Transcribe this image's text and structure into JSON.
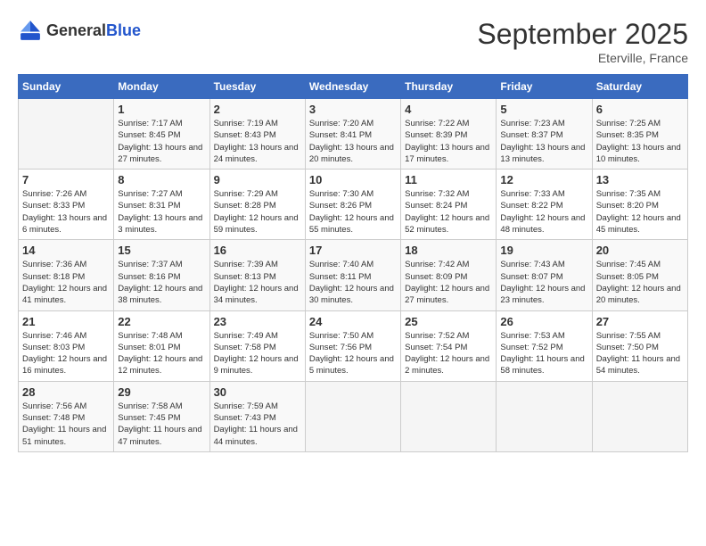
{
  "header": {
    "logo_general": "General",
    "logo_blue": "Blue",
    "month": "September 2025",
    "location": "Eterville, France"
  },
  "weekdays": [
    "Sunday",
    "Monday",
    "Tuesday",
    "Wednesday",
    "Thursday",
    "Friday",
    "Saturday"
  ],
  "weeks": [
    [
      {
        "day": "",
        "empty": true
      },
      {
        "day": "1",
        "sunrise": "7:17 AM",
        "sunset": "8:45 PM",
        "daylight": "13 hours and 27 minutes."
      },
      {
        "day": "2",
        "sunrise": "7:19 AM",
        "sunset": "8:43 PM",
        "daylight": "13 hours and 24 minutes."
      },
      {
        "day": "3",
        "sunrise": "7:20 AM",
        "sunset": "8:41 PM",
        "daylight": "13 hours and 20 minutes."
      },
      {
        "day": "4",
        "sunrise": "7:22 AM",
        "sunset": "8:39 PM",
        "daylight": "13 hours and 17 minutes."
      },
      {
        "day": "5",
        "sunrise": "7:23 AM",
        "sunset": "8:37 PM",
        "daylight": "13 hours and 13 minutes."
      },
      {
        "day": "6",
        "sunrise": "7:25 AM",
        "sunset": "8:35 PM",
        "daylight": "13 hours and 10 minutes."
      }
    ],
    [
      {
        "day": "7",
        "sunrise": "7:26 AM",
        "sunset": "8:33 PM",
        "daylight": "13 hours and 6 minutes."
      },
      {
        "day": "8",
        "sunrise": "7:27 AM",
        "sunset": "8:31 PM",
        "daylight": "13 hours and 3 minutes."
      },
      {
        "day": "9",
        "sunrise": "7:29 AM",
        "sunset": "8:28 PM",
        "daylight": "12 hours and 59 minutes."
      },
      {
        "day": "10",
        "sunrise": "7:30 AM",
        "sunset": "8:26 PM",
        "daylight": "12 hours and 55 minutes."
      },
      {
        "day": "11",
        "sunrise": "7:32 AM",
        "sunset": "8:24 PM",
        "daylight": "12 hours and 52 minutes."
      },
      {
        "day": "12",
        "sunrise": "7:33 AM",
        "sunset": "8:22 PM",
        "daylight": "12 hours and 48 minutes."
      },
      {
        "day": "13",
        "sunrise": "7:35 AM",
        "sunset": "8:20 PM",
        "daylight": "12 hours and 45 minutes."
      }
    ],
    [
      {
        "day": "14",
        "sunrise": "7:36 AM",
        "sunset": "8:18 PM",
        "daylight": "12 hours and 41 minutes."
      },
      {
        "day": "15",
        "sunrise": "7:37 AM",
        "sunset": "8:16 PM",
        "daylight": "12 hours and 38 minutes."
      },
      {
        "day": "16",
        "sunrise": "7:39 AM",
        "sunset": "8:13 PM",
        "daylight": "12 hours and 34 minutes."
      },
      {
        "day": "17",
        "sunrise": "7:40 AM",
        "sunset": "8:11 PM",
        "daylight": "12 hours and 30 minutes."
      },
      {
        "day": "18",
        "sunrise": "7:42 AM",
        "sunset": "8:09 PM",
        "daylight": "12 hours and 27 minutes."
      },
      {
        "day": "19",
        "sunrise": "7:43 AM",
        "sunset": "8:07 PM",
        "daylight": "12 hours and 23 minutes."
      },
      {
        "day": "20",
        "sunrise": "7:45 AM",
        "sunset": "8:05 PM",
        "daylight": "12 hours and 20 minutes."
      }
    ],
    [
      {
        "day": "21",
        "sunrise": "7:46 AM",
        "sunset": "8:03 PM",
        "daylight": "12 hours and 16 minutes."
      },
      {
        "day": "22",
        "sunrise": "7:48 AM",
        "sunset": "8:01 PM",
        "daylight": "12 hours and 12 minutes."
      },
      {
        "day": "23",
        "sunrise": "7:49 AM",
        "sunset": "7:58 PM",
        "daylight": "12 hours and 9 minutes."
      },
      {
        "day": "24",
        "sunrise": "7:50 AM",
        "sunset": "7:56 PM",
        "daylight": "12 hours and 5 minutes."
      },
      {
        "day": "25",
        "sunrise": "7:52 AM",
        "sunset": "7:54 PM",
        "daylight": "12 hours and 2 minutes."
      },
      {
        "day": "26",
        "sunrise": "7:53 AM",
        "sunset": "7:52 PM",
        "daylight": "11 hours and 58 minutes."
      },
      {
        "day": "27",
        "sunrise": "7:55 AM",
        "sunset": "7:50 PM",
        "daylight": "11 hours and 54 minutes."
      }
    ],
    [
      {
        "day": "28",
        "sunrise": "7:56 AM",
        "sunset": "7:48 PM",
        "daylight": "11 hours and 51 minutes."
      },
      {
        "day": "29",
        "sunrise": "7:58 AM",
        "sunset": "7:45 PM",
        "daylight": "11 hours and 47 minutes."
      },
      {
        "day": "30",
        "sunrise": "7:59 AM",
        "sunset": "7:43 PM",
        "daylight": "11 hours and 44 minutes."
      },
      {
        "day": "",
        "empty": true
      },
      {
        "day": "",
        "empty": true
      },
      {
        "day": "",
        "empty": true
      },
      {
        "day": "",
        "empty": true
      }
    ]
  ]
}
